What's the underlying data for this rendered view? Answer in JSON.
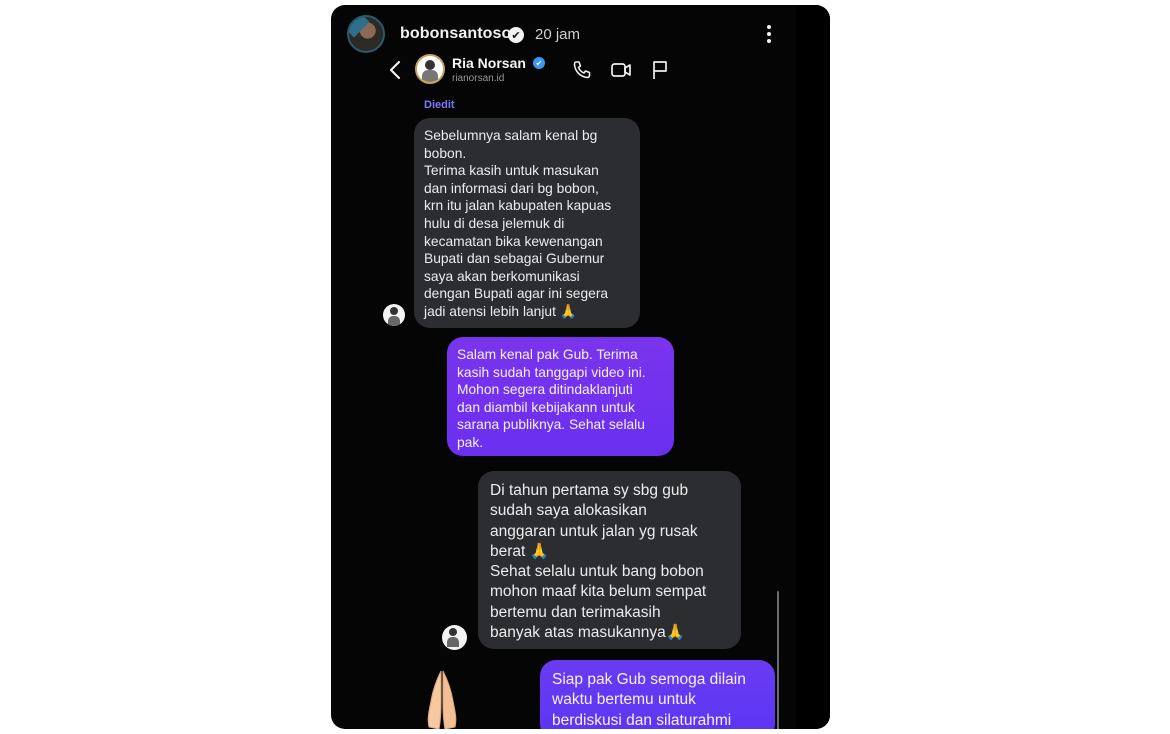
{
  "story": {
    "username": "bobonsantoso",
    "time": "20 jam",
    "verified_mark": "✔"
  },
  "dm": {
    "contact_name": "Ria Norsan",
    "contact_handle": "rianorsan.id",
    "verified_mark": "✔",
    "edited_label": "Diedit"
  },
  "icons": {
    "more": "more-vertical-icon",
    "back": "chevron-left-icon",
    "call": "phone-icon",
    "video": "video-camera-icon",
    "report": "flag-icon",
    "reaction": "praying-hands-icon"
  },
  "messages": [
    {
      "direction": "received",
      "text": "Sebelumnya salam kenal bg\nbobon.\nTerima kasih untuk masukan\ndan informasi dari bg bobon,\nkrn itu jalan kabupaten kapuas\nhulu di desa jelemuk di\nkecamatan bika kewenangan\nBupati dan sebagai Gubernur\nsaya akan berkomunikasi\ndengan Bupati agar ini segera\njadi atensi lebih lanjut 🙏"
    },
    {
      "direction": "sent",
      "text": "Salam kenal pak Gub. Terima\nkasih sudah tanggapi video ini.\nMohon segera ditindaklanjuti\ndan diambil kebijakann untuk\nsarana publiknya. Sehat selalu\npak."
    },
    {
      "direction": "received",
      "text": "Di tahun pertama sy sbg gub\nsudah saya alokasikan\nanggaran untuk jalan yg rusak\nberat 🙏\nSehat selalu untuk bang bobon\nmohon maaf kita belum sempat\nbertemu dan terimakasih\nbanyak atas masukannya🙏"
    },
    {
      "direction": "sent",
      "text": "Siap pak Gub semoga dilain\nwaktu bertemu untuk\nberdiskusi dan silaturahmi"
    }
  ],
  "colors": {
    "background": "#050505",
    "received_bubble": "#2c2d31",
    "sent_bubble": "#7a34ec",
    "edited_label": "#7d76ff",
    "verified_badge": "#3897f0"
  }
}
